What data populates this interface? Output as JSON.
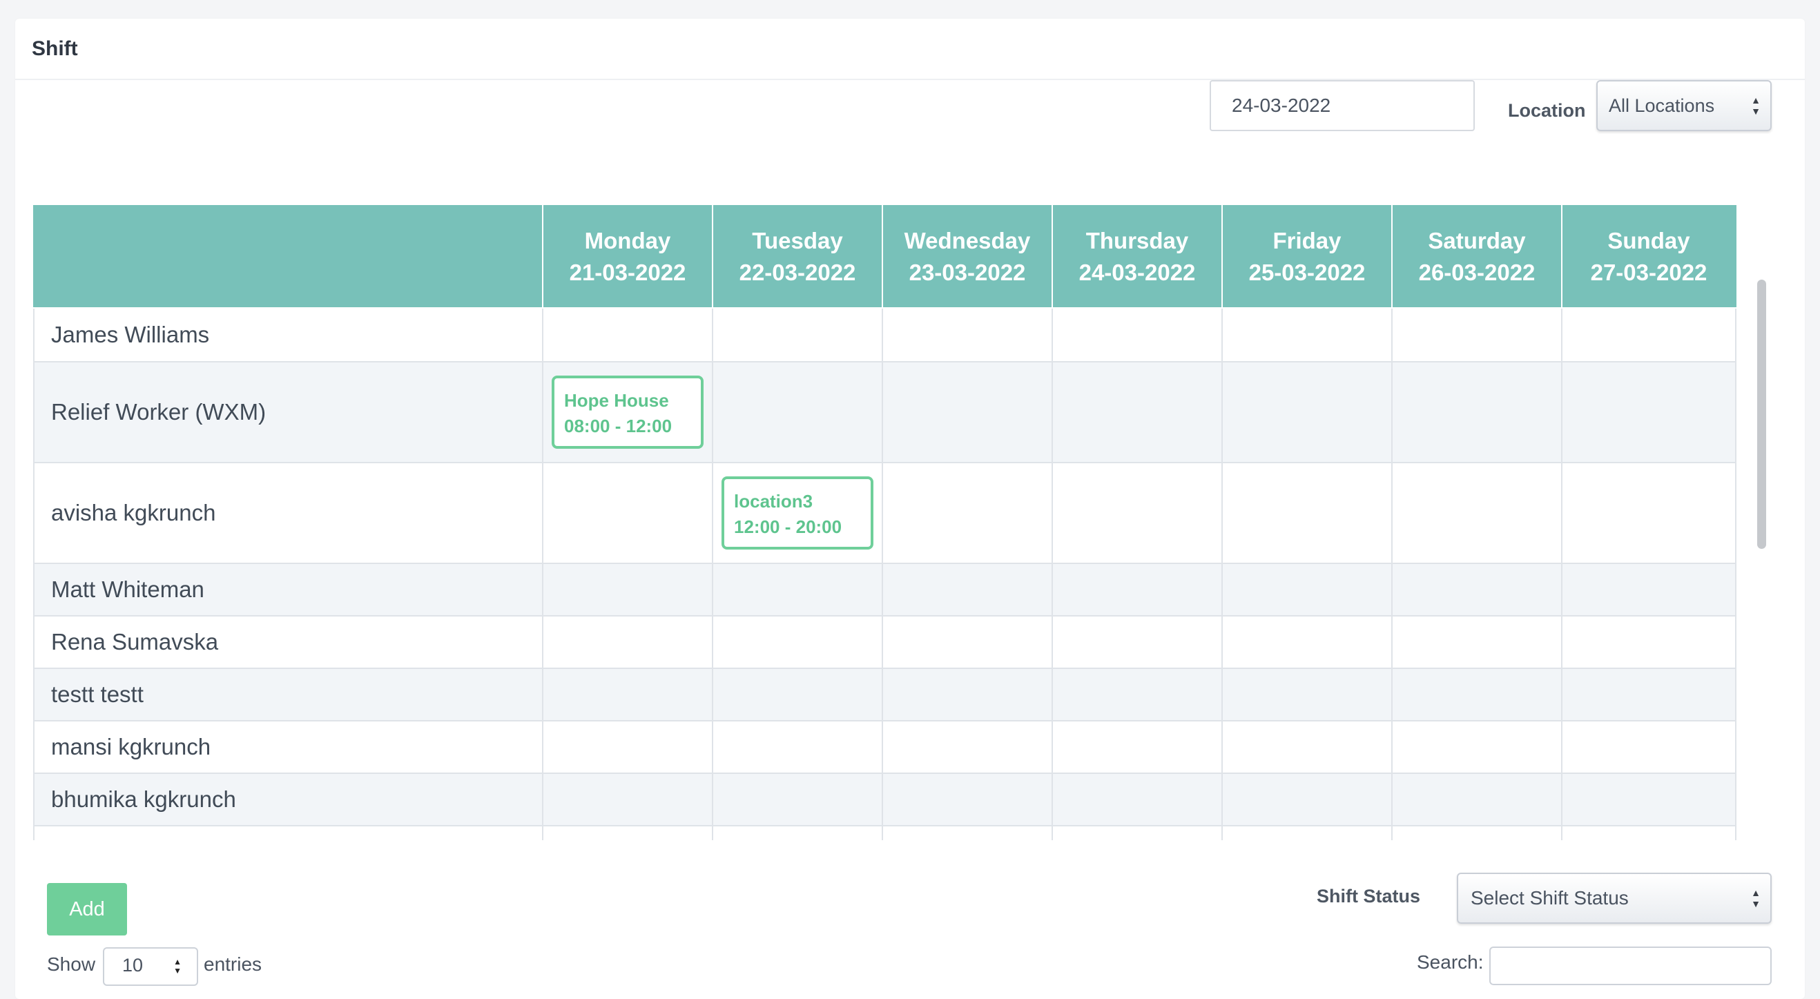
{
  "card": {
    "title": "Shift"
  },
  "filters": {
    "date_value": "24-03-2022",
    "location_label": "Location",
    "location_selected": "All Locations"
  },
  "schedule": {
    "days": [
      {
        "name": "Monday",
        "date": "21-03-2022"
      },
      {
        "name": "Tuesday",
        "date": "22-03-2022"
      },
      {
        "name": "Wednesday",
        "date": "23-03-2022"
      },
      {
        "name": "Thursday",
        "date": "24-03-2022"
      },
      {
        "name": "Friday",
        "date": "25-03-2022"
      },
      {
        "name": "Saturday",
        "date": "26-03-2022"
      },
      {
        "name": "Sunday",
        "date": "27-03-2022"
      }
    ],
    "employees": [
      {
        "name": "James Williams"
      },
      {
        "name": "Relief Worker (WXM)"
      },
      {
        "name": "avisha kgkrunch"
      },
      {
        "name": "Matt Whiteman"
      },
      {
        "name": "Rena Sumavska"
      },
      {
        "name": "testt testt"
      },
      {
        "name": "mansi kgkrunch"
      },
      {
        "name": "bhumika kgkrunch"
      }
    ],
    "shifts": [
      {
        "employee": "Relief Worker (WXM)",
        "day": "Monday",
        "location": "Hope House",
        "time": "08:00 - 12:00"
      },
      {
        "employee": "avisha kgkrunch",
        "day": "Tuesday",
        "location": "location3",
        "time": "12:00 - 20:00"
      }
    ]
  },
  "controls": {
    "add_label": "Add",
    "shift_status_label": "Shift Status",
    "shift_status_placeholder": "Select Shift Status",
    "show_label": "Show",
    "entries_value": "10",
    "entries_label": "entries",
    "search_label": "Search:",
    "search_value": ""
  },
  "colors": {
    "header_bg": "#78c1b9",
    "accent_green": "#6fcf9a",
    "chip_text": "#5ec48e",
    "alt_row": "#f2f5f8"
  },
  "icons": {
    "select_arrows": "up-down-caret-icon"
  }
}
